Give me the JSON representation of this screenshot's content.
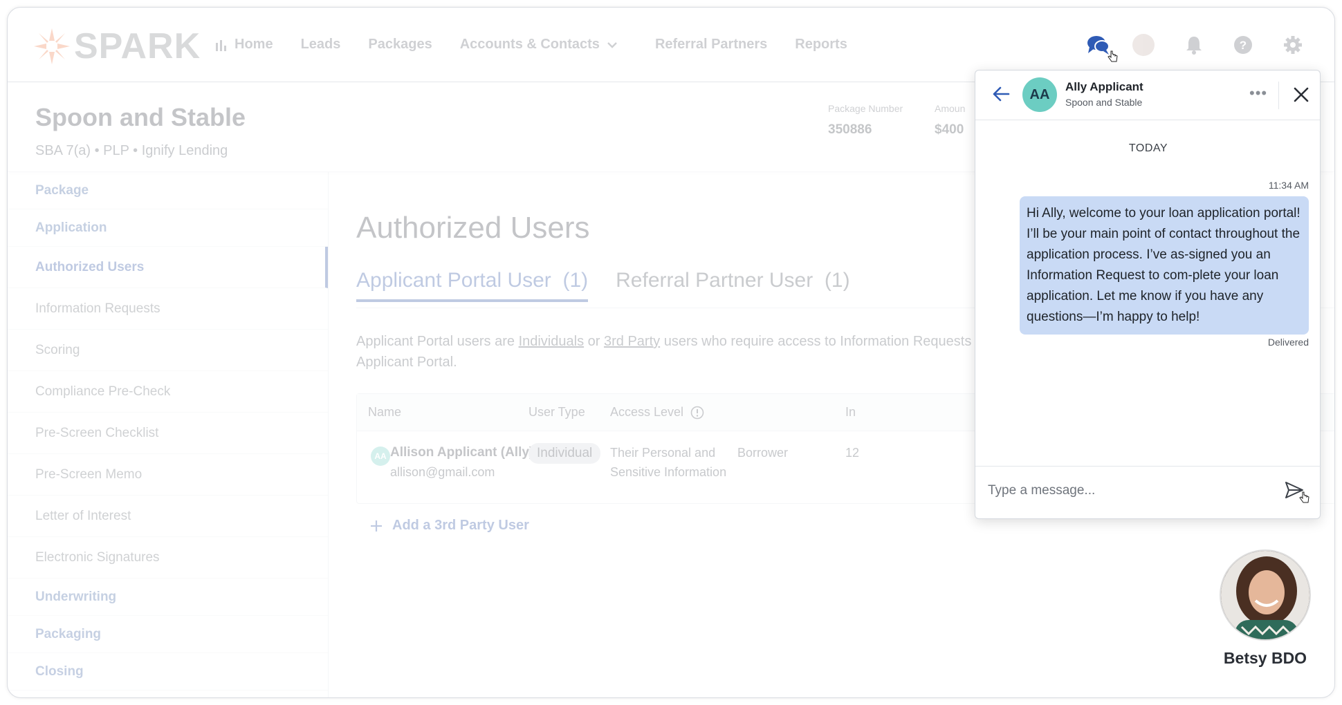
{
  "app": {
    "brand": "SPARK"
  },
  "nav": {
    "items": [
      {
        "label": "Home"
      },
      {
        "label": "Leads"
      },
      {
        "label": "Packages"
      },
      {
        "label": "Accounts & Contacts"
      },
      {
        "label": "Referral Partners"
      },
      {
        "label": "Reports"
      }
    ]
  },
  "package": {
    "title": "Spoon and Stable",
    "subtitle": "SBA 7(a) • PLP • Ignify Lending",
    "number_label": "Package Number",
    "number_value": "350886",
    "amount_label": "Amoun",
    "amount_value": "$400"
  },
  "sidebar": {
    "items": [
      {
        "label": "Package"
      },
      {
        "label": "Application"
      },
      {
        "label": "Authorized Users"
      },
      {
        "label": "Information Requests"
      },
      {
        "label": "Scoring"
      },
      {
        "label": "Compliance Pre-Check"
      },
      {
        "label": "Pre-Screen Checklist"
      },
      {
        "label": "Pre-Screen Memo"
      },
      {
        "label": "Letter of Interest"
      },
      {
        "label": "Electronic Signatures"
      },
      {
        "label": "Underwriting"
      },
      {
        "label": "Packaging"
      },
      {
        "label": "Closing"
      }
    ]
  },
  "main": {
    "title": "Authorized Users",
    "tabs": [
      {
        "label": "Applicant Portal User",
        "count": "(1)"
      },
      {
        "label": "Referral Partner User",
        "count": "(1)"
      }
    ],
    "desc": {
      "pre": "Applicant Portal users are ",
      "link1": "Individuals",
      "mid": " or ",
      "link2": "3rd Party",
      "post": " users who require access to Information Requests",
      "line2": "Applicant Portal."
    },
    "table": {
      "headers": [
        "Name",
        "User Type",
        "Access Level",
        "In"
      ],
      "row": {
        "initials": "AA",
        "name": "Allison Applicant (Ally)",
        "email": "allison@gmail.com",
        "user_type": "Individual",
        "access_line1": "Their Personal and",
        "access_line2": "Sensitive Information",
        "role": "Borrower",
        "extra": "12"
      }
    },
    "add_label": "Add a 3rd Party User"
  },
  "chat": {
    "initials": "AA",
    "name": "Ally Applicant",
    "org": "Spoon and Stable",
    "more": "•••",
    "day": "TODAY",
    "time": "11:34 AM",
    "message": "Hi Ally, welcome to your loan application portal! I’ll be your main point of contact throughout the application process. I’ve as-signed you an Information Request to com-plete your loan application. Let me know if you have any questions—I’m happy to help!",
    "status": "Delivered",
    "placeholder": "Type a message..."
  },
  "presenter": {
    "name": "Betsy BDO"
  },
  "colors": {
    "accent": "#3b5ea8",
    "bubble": "#c9daf5",
    "avatar": "#6ccdc2"
  }
}
